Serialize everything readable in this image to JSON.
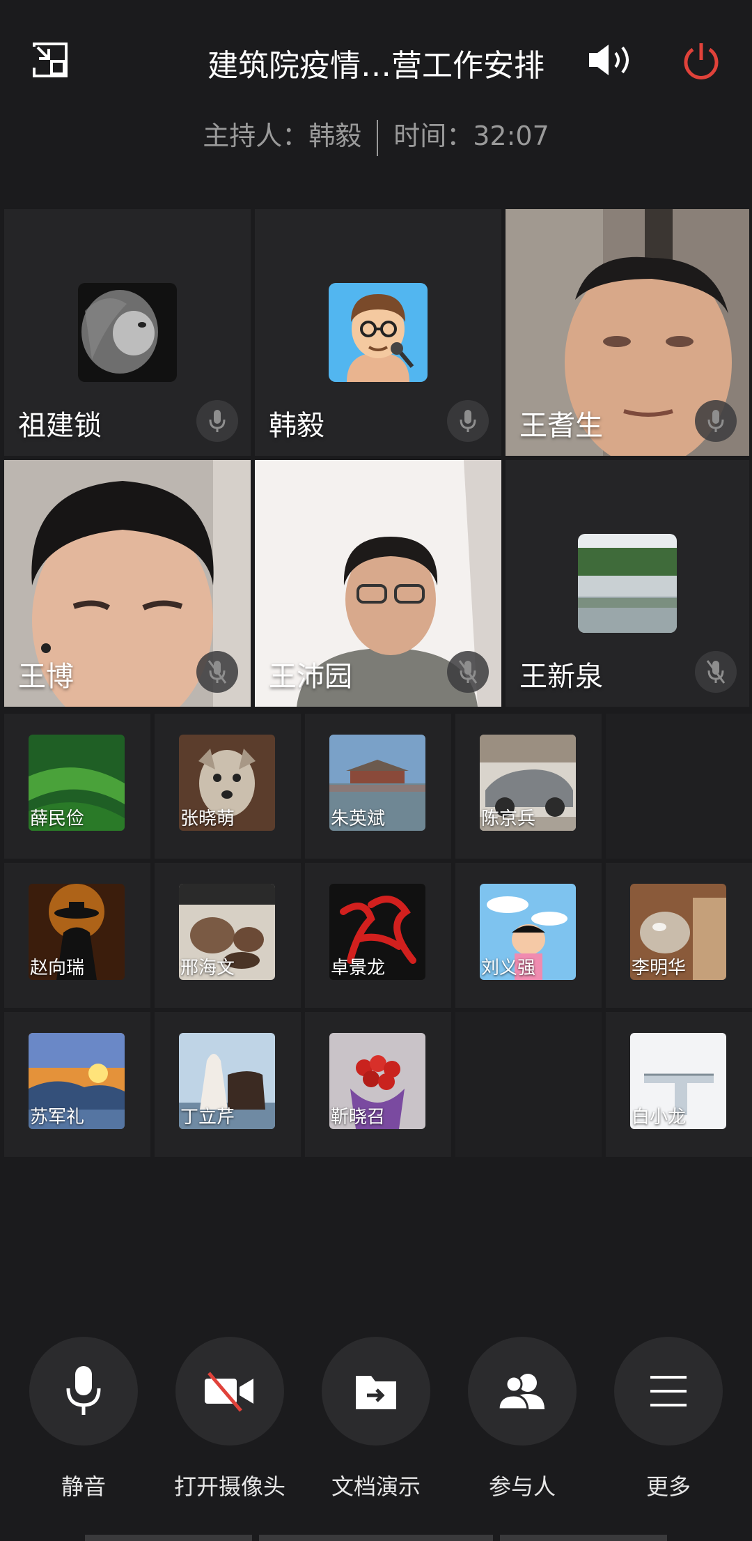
{
  "header": {
    "title": "建筑院疫情…营工作安排",
    "host_label": "主持人：韩毅",
    "time_label": "时间：32:07"
  },
  "participants_main": [
    {
      "name": "祖建锁"
    },
    {
      "name": "韩毅"
    },
    {
      "name": "王耆生"
    },
    {
      "name": "王博"
    },
    {
      "name": "王沛园"
    },
    {
      "name": "王新泉"
    }
  ],
  "participants_grid": [
    {
      "name": "薛民俭"
    },
    {
      "name": "张晓萌"
    },
    {
      "name": "朱英斌"
    },
    {
      "name": "陈京兵"
    },
    {
      "name": "赵向瑞"
    },
    {
      "name": "邢海文"
    },
    {
      "name": "卓景龙"
    },
    {
      "name": "刘义强"
    },
    {
      "name": "李明华"
    },
    {
      "name": "苏军礼"
    },
    {
      "name": "丁立芹"
    },
    {
      "name": "靳晓召"
    },
    {
      "name": "白小龙"
    }
  ],
  "controls": {
    "mute": "静音",
    "camera": "打开摄像头",
    "share": "文档演示",
    "participants": "参与人",
    "more": "更多"
  },
  "colors": {
    "accent_red": "#e0423a",
    "background": "#1b1b1d"
  }
}
